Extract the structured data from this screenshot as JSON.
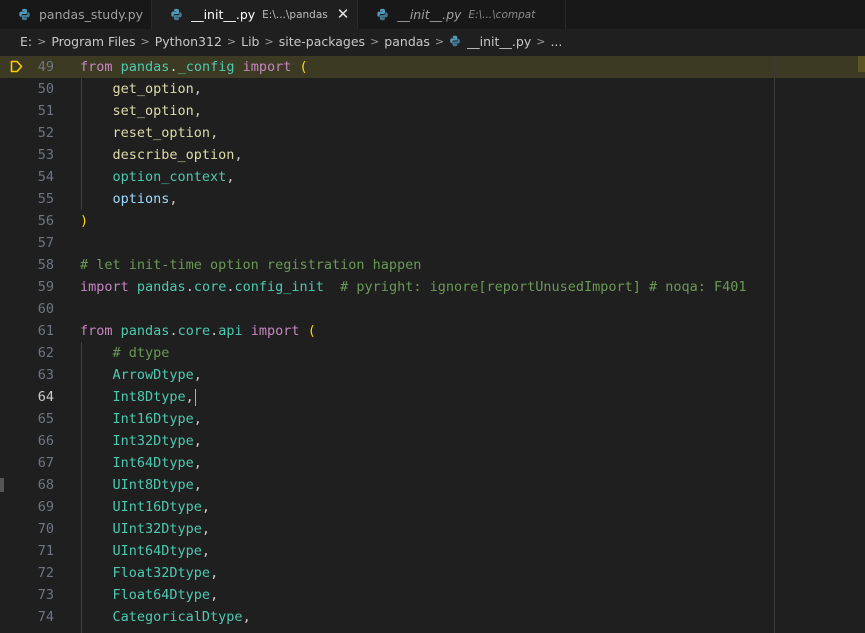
{
  "tabs": [
    {
      "name": "pandas_study.py",
      "dir": "",
      "active": false,
      "italic": false
    },
    {
      "name": "__init__.py",
      "dir": "E:\\...\\pandas",
      "active": true,
      "italic": false
    },
    {
      "name": "__init__.py",
      "dir": "E:\\...\\compat",
      "active": false,
      "italic": true
    }
  ],
  "breadcrumb": [
    "E:",
    "Program Files",
    "Python312",
    "Lib",
    "site-packages",
    "pandas",
    "__init__.py",
    "..."
  ],
  "cursor_line": "64",
  "breakpoint_line": "49",
  "lines": [
    {
      "n": "49",
      "tokens": [
        {
          "t": "from",
          "c": "kw"
        },
        {
          "t": " ",
          "c": "plain"
        },
        {
          "t": "pandas",
          "c": "ns"
        },
        {
          "t": ".",
          "c": "plain"
        },
        {
          "t": "_config",
          "c": "ns"
        },
        {
          "t": " ",
          "c": "plain"
        },
        {
          "t": "import",
          "c": "kw"
        },
        {
          "t": " ",
          "c": "plain"
        },
        {
          "t": "(",
          "c": "paren"
        }
      ]
    },
    {
      "n": "50",
      "tokens": [
        {
          "t": "    ",
          "c": "plain"
        },
        {
          "t": "get_option",
          "c": "fn"
        },
        {
          "t": ",",
          "c": "plain"
        }
      ]
    },
    {
      "n": "51",
      "tokens": [
        {
          "t": "    ",
          "c": "plain"
        },
        {
          "t": "set_option",
          "c": "fn"
        },
        {
          "t": ",",
          "c": "plain"
        }
      ]
    },
    {
      "n": "52",
      "tokens": [
        {
          "t": "    ",
          "c": "plain"
        },
        {
          "t": "reset_option",
          "c": "fn"
        },
        {
          "t": ",",
          "c": "plain"
        }
      ]
    },
    {
      "n": "53",
      "tokens": [
        {
          "t": "    ",
          "c": "plain"
        },
        {
          "t": "describe_option",
          "c": "fn"
        },
        {
          "t": ",",
          "c": "plain"
        }
      ]
    },
    {
      "n": "54",
      "tokens": [
        {
          "t": "    ",
          "c": "plain"
        },
        {
          "t": "option_context",
          "c": "cls"
        },
        {
          "t": ",",
          "c": "plain"
        }
      ]
    },
    {
      "n": "55",
      "tokens": [
        {
          "t": "    ",
          "c": "plain"
        },
        {
          "t": "options",
          "c": "var"
        },
        {
          "t": ",",
          "c": "plain"
        }
      ]
    },
    {
      "n": "56",
      "tokens": [
        {
          "t": ")",
          "c": "paren"
        }
      ]
    },
    {
      "n": "57",
      "tokens": []
    },
    {
      "n": "58",
      "tokens": [
        {
          "t": "# let init-time option registration happen",
          "c": "cm"
        }
      ]
    },
    {
      "n": "59",
      "tokens": [
        {
          "t": "import",
          "c": "kw"
        },
        {
          "t": " ",
          "c": "plain"
        },
        {
          "t": "pandas",
          "c": "ns"
        },
        {
          "t": ".",
          "c": "plain"
        },
        {
          "t": "core",
          "c": "ns"
        },
        {
          "t": ".",
          "c": "plain"
        },
        {
          "t": "config_init",
          "c": "ns"
        },
        {
          "t": "  ",
          "c": "plain"
        },
        {
          "t": "# pyright: ignore[reportUnusedImport] # noqa: F401",
          "c": "cm"
        }
      ]
    },
    {
      "n": "60",
      "tokens": []
    },
    {
      "n": "61",
      "tokens": [
        {
          "t": "from",
          "c": "kw"
        },
        {
          "t": " ",
          "c": "plain"
        },
        {
          "t": "pandas",
          "c": "ns"
        },
        {
          "t": ".",
          "c": "plain"
        },
        {
          "t": "core",
          "c": "ns"
        },
        {
          "t": ".",
          "c": "plain"
        },
        {
          "t": "api",
          "c": "ns"
        },
        {
          "t": " ",
          "c": "plain"
        },
        {
          "t": "import",
          "c": "kw"
        },
        {
          "t": " ",
          "c": "plain"
        },
        {
          "t": "(",
          "c": "paren"
        }
      ]
    },
    {
      "n": "62",
      "tokens": [
        {
          "t": "    ",
          "c": "plain"
        },
        {
          "t": "# dtype",
          "c": "cm"
        }
      ]
    },
    {
      "n": "63",
      "tokens": [
        {
          "t": "    ",
          "c": "plain"
        },
        {
          "t": "ArrowDtype",
          "c": "cls"
        },
        {
          "t": ",",
          "c": "plain"
        }
      ]
    },
    {
      "n": "64",
      "tokens": [
        {
          "t": "    ",
          "c": "plain"
        },
        {
          "t": "Int8Dtype",
          "c": "cls"
        },
        {
          "t": ",",
          "c": "plain"
        }
      ]
    },
    {
      "n": "65",
      "tokens": [
        {
          "t": "    ",
          "c": "plain"
        },
        {
          "t": "Int16Dtype",
          "c": "cls"
        },
        {
          "t": ",",
          "c": "plain"
        }
      ]
    },
    {
      "n": "66",
      "tokens": [
        {
          "t": "    ",
          "c": "plain"
        },
        {
          "t": "Int32Dtype",
          "c": "cls"
        },
        {
          "t": ",",
          "c": "plain"
        }
      ]
    },
    {
      "n": "67",
      "tokens": [
        {
          "t": "    ",
          "c": "plain"
        },
        {
          "t": "Int64Dtype",
          "c": "cls"
        },
        {
          "t": ",",
          "c": "plain"
        }
      ]
    },
    {
      "n": "68",
      "tokens": [
        {
          "t": "    ",
          "c": "plain"
        },
        {
          "t": "UInt8Dtype",
          "c": "cls"
        },
        {
          "t": ",",
          "c": "plain"
        }
      ]
    },
    {
      "n": "69",
      "tokens": [
        {
          "t": "    ",
          "c": "plain"
        },
        {
          "t": "UInt16Dtype",
          "c": "cls"
        },
        {
          "t": ",",
          "c": "plain"
        }
      ]
    },
    {
      "n": "70",
      "tokens": [
        {
          "t": "    ",
          "c": "plain"
        },
        {
          "t": "UInt32Dtype",
          "c": "cls"
        },
        {
          "t": ",",
          "c": "plain"
        }
      ]
    },
    {
      "n": "71",
      "tokens": [
        {
          "t": "    ",
          "c": "plain"
        },
        {
          "t": "UInt64Dtype",
          "c": "cls"
        },
        {
          "t": ",",
          "c": "plain"
        }
      ]
    },
    {
      "n": "72",
      "tokens": [
        {
          "t": "    ",
          "c": "plain"
        },
        {
          "t": "Float32Dtype",
          "c": "cls"
        },
        {
          "t": ",",
          "c": "plain"
        }
      ]
    },
    {
      "n": "73",
      "tokens": [
        {
          "t": "    ",
          "c": "plain"
        },
        {
          "t": "Float64Dtype",
          "c": "cls"
        },
        {
          "t": ",",
          "c": "plain"
        }
      ]
    },
    {
      "n": "74",
      "tokens": [
        {
          "t": "    ",
          "c": "plain"
        },
        {
          "t": "CategoricalDtype",
          "c": "cls"
        },
        {
          "t": ",",
          "c": "plain"
        }
      ]
    }
  ],
  "colors": {
    "background": "#1f1f1f",
    "current_line": "#3c3a22",
    "python_icon": "#519aba",
    "breakpoint": "#ffcc00"
  },
  "icons": {
    "tab_file": "python-file-icon",
    "breakpoint": "debug-breakpoint-icon",
    "close": "close-icon",
    "separator": "chevron-right-icon"
  }
}
